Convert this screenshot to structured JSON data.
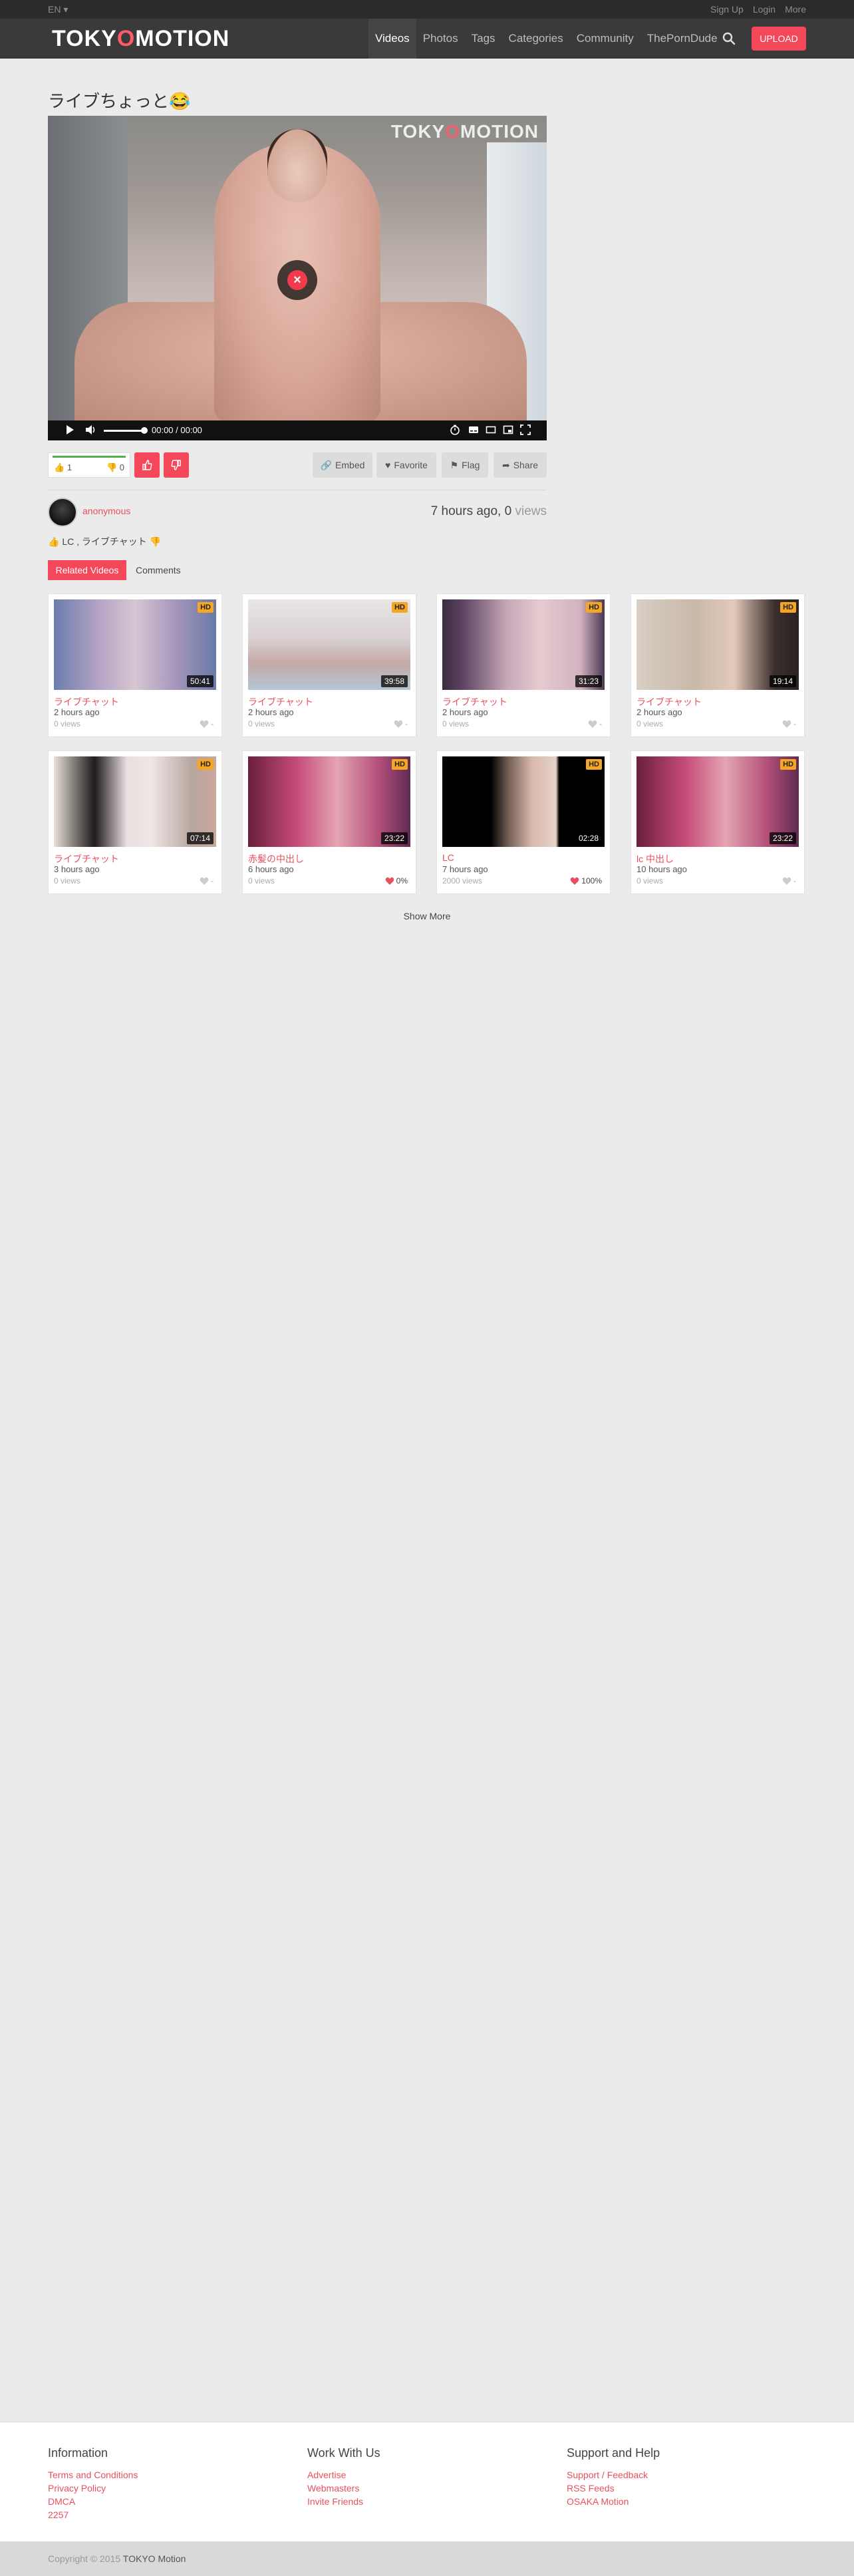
{
  "topbar": {
    "lang": "EN ▾",
    "links": [
      "Sign Up",
      "Login",
      "More"
    ]
  },
  "logo": {
    "part1": "TOKY",
    "accent": "O",
    "part2": "MOTION"
  },
  "nav": {
    "items": [
      "Videos",
      "Photos",
      "Tags",
      "Categories",
      "Community",
      "ThePornDude"
    ],
    "active": "Videos",
    "upload_label": "UPLOAD"
  },
  "video": {
    "title": "ライブちょっと😂",
    "time": "00:00 / 00:00",
    "likes": "1",
    "dislikes": "0",
    "rating_fraction": 1.0
  },
  "actions": {
    "embed": "Embed",
    "favorite": "Favorite",
    "flag": "Flag",
    "share": "Share"
  },
  "uploader": {
    "name": "anonymous"
  },
  "meta": {
    "ago": "7 hours ago,",
    "views_count": "0",
    "views_word": "views"
  },
  "tags": {
    "text": "LC , ライブチャット"
  },
  "tabs": {
    "related": "Related Videos",
    "comments": "Comments"
  },
  "related": [
    {
      "title": "ライブチャット",
      "ago": "2 hours ago",
      "views": "0 views",
      "duration": "50:41",
      "hd": "HD",
      "rating": "-"
    },
    {
      "title": "ライブチャット",
      "ago": "2 hours ago",
      "views": "0 views",
      "duration": "39:58",
      "hd": "HD",
      "rating": "-"
    },
    {
      "title": "ライブチャット",
      "ago": "2 hours ago",
      "views": "0 views",
      "duration": "31:23",
      "hd": "HD",
      "rating": "-"
    },
    {
      "title": "ライブチャット",
      "ago": "2 hours ago",
      "views": "0 views",
      "duration": "19:14",
      "hd": "HD",
      "rating": "-"
    },
    {
      "title": "ライブチャット",
      "ago": "3 hours ago",
      "views": "0 views",
      "duration": "07:14",
      "hd": "HD",
      "rating": "-"
    },
    {
      "title": "赤髪の中出し",
      "ago": "6 hours ago",
      "views": "0 views",
      "duration": "23:22",
      "hd": "HD",
      "rating": "0%"
    },
    {
      "title": "LC",
      "ago": "7 hours ago",
      "views": "2000 views",
      "duration": "02:28",
      "hd": "HD",
      "rating": "100%"
    },
    {
      "title": "lc 中出し",
      "ago": "10 hours ago",
      "views": "0 views",
      "duration": "23:22",
      "hd": "HD",
      "rating": "-"
    }
  ],
  "show_more": "Show More",
  "footer": {
    "info": {
      "heading": "Information",
      "links": [
        "Terms and Conditions",
        "Privacy Policy",
        "DMCA",
        "2257"
      ]
    },
    "work": {
      "heading": "Work With Us",
      "links": [
        "Advertise",
        "Webmasters",
        "Invite Friends"
      ]
    },
    "support": {
      "heading": "Support and Help",
      "links": [
        "Support / Feedback",
        "RSS Feeds",
        "OSAKA Motion"
      ]
    },
    "copyright_prefix": "Copyright © 2015",
    "copyright_brand": "TOKYO Motion"
  },
  "colors": {
    "accent": "#f4485a",
    "link": "#e8505f",
    "hd_badge": "#f5a623"
  }
}
